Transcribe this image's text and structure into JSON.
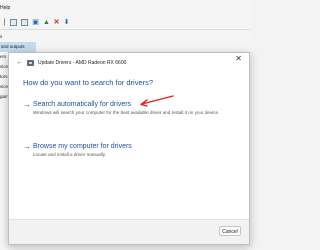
{
  "background": {
    "menu_fragment": "Help",
    "tree_items": [
      {
        "label": "s",
        "selected": false
      },
      {
        "label": "and outputs",
        "selected": true
      },
      {
        "label": "",
        "selected": false
      },
      {
        "label": "",
        "selected": false
      },
      {
        "label": "ers",
        "selected": false
      },
      {
        "label": "vices",
        "selected": false
      },
      {
        "label": "tors",
        "selected": false
      },
      {
        "label": "",
        "selected": false
      },
      {
        "label": "",
        "selected": false
      },
      {
        "label": "",
        "selected": false
      },
      {
        "label": "",
        "selected": false
      },
      {
        "label": "vices",
        "selected": false
      },
      {
        "label": "game controllers",
        "selected": false
      }
    ],
    "toolbar_icons": [
      "properties-icon",
      "update-driver-icon",
      "scan-icon",
      "enable-device-icon",
      "uninstall-icon",
      "download-icon"
    ]
  },
  "dialog": {
    "title": "Update Drivers - AMD Radeon RX 6600",
    "heading": "How do you want to search for drivers?",
    "option_automatic": {
      "title": "Search automatically for drivers",
      "description": "Windows will search your computer for the best available driver and install it on your device."
    },
    "option_manual": {
      "title": "Browse my computer for drivers",
      "description": "Locate and install a driver manually."
    },
    "cancel_label": "Cancel",
    "annotation_color": "#e02020",
    "accent_color": "#1f4e9c"
  }
}
